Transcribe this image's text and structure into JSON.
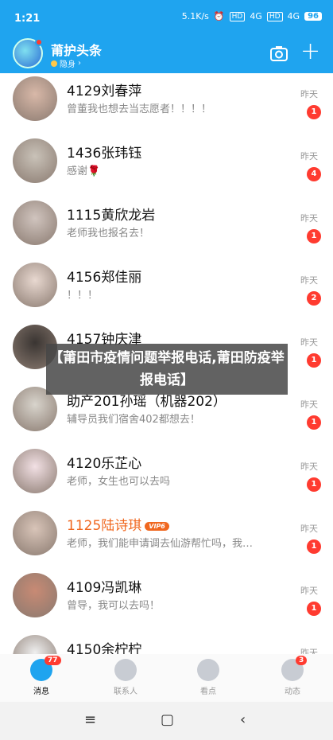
{
  "status_bar": {
    "time": "1:21",
    "speed": "5.1K/s",
    "net1": "HD",
    "sig1": "4G",
    "net2": "HD",
    "sig2": "4G",
    "battery": "96"
  },
  "header": {
    "title": "莆护头条",
    "subtitle": "隐身",
    "camera_icon": "camera-icon",
    "add_icon": "plus-icon"
  },
  "conversations": [
    {
      "name": "4129刘春萍",
      "message": "曾董我也想去当志愿者！！！！",
      "time": "昨天",
      "unread": "1"
    },
    {
      "name": "1436张玮钰",
      "message": "感谢🌹",
      "time": "昨天",
      "unread": "4"
    },
    {
      "name": "1115黄欣龙岩",
      "message": "老师我也报名去！",
      "time": "昨天",
      "unread": "1"
    },
    {
      "name": "4156郑佳丽",
      "message": "！！！",
      "time": "昨天",
      "unread": "2"
    },
    {
      "name": "4157钟庆津",
      "message": "",
      "time": "昨天",
      "unread": "1"
    },
    {
      "name": "助产201孙瑶（机器202）",
      "message": "辅导员我们宿舍402都想去！",
      "time": "昨天",
      "unread": "1"
    },
    {
      "name": "4120乐芷心",
      "message": "老师，女生也可以去吗",
      "time": "昨天",
      "unread": "1"
    },
    {
      "name": "1125陆诗琪",
      "message": "老师，我们能申请调去仙游帮忙吗，我…",
      "time": "昨天",
      "unread": "1",
      "vip": "VIP6"
    },
    {
      "name": "4109冯凯琳",
      "message": "曾导，我可以去吗！",
      "time": "昨天",
      "unread": "1"
    },
    {
      "name": "4150余柠柠",
      "message": "",
      "time": "昨天",
      "unread": ""
    }
  ],
  "banner": {
    "text": "【莆田市疫情问题举报电话,莆田防疫举报电话】"
  },
  "bottom_nav": [
    {
      "label": "消息",
      "count": "77"
    },
    {
      "label": "联系人",
      "count": ""
    },
    {
      "label": "看点",
      "count": ""
    },
    {
      "label": "动态",
      "count": "3"
    }
  ],
  "colors": {
    "brand": "#1fa4ef",
    "badge": "#ff3b30",
    "vip": "#f0671f"
  }
}
